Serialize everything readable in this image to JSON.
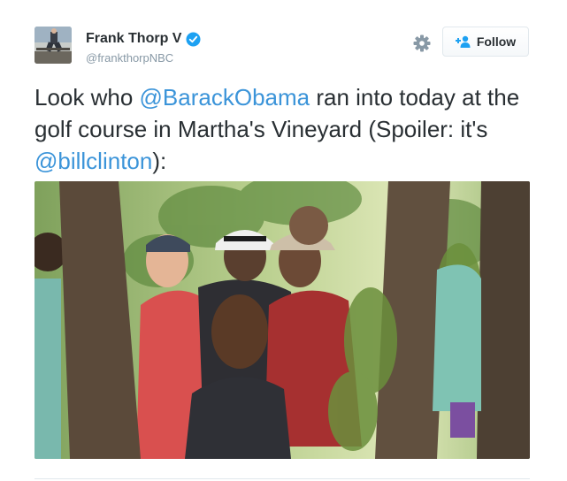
{
  "author": {
    "display_name": "Frank Thorp V",
    "handle": "@frankthorpNBC",
    "verified": true,
    "avatar_icon": "profile-photo"
  },
  "actions": {
    "settings_icon": "gear-icon",
    "follow_label": "Follow",
    "follow_icon": "add-user-icon"
  },
  "tweet": {
    "text_1": "Look who ",
    "mention_1": "@BarackObama",
    "text_2": " ran into today at the golf course in Martha's Vineyard (Spoiler: it's ",
    "mention_2": "@billclinton",
    "text_3": "):"
  },
  "colors": {
    "link": "#3b94d9",
    "text": "#292f33",
    "muted": "#8899a6",
    "verified": "#1da1f2"
  }
}
